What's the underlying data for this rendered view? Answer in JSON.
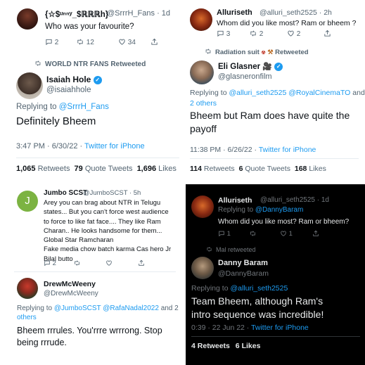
{
  "panel1": {
    "top_tweet": {
      "name": "{☆$ᵘⁿⁿʸ_$ℝℝℝh}",
      "handle": "@SrrrH_Fans · 1d",
      "text": "Who was your favourite?",
      "replies": "2",
      "retweets": "12",
      "likes": "34"
    },
    "retweeted_by": "WORLD NTR FANS Retweeted",
    "author_name": "Isaiah Hole",
    "author_handle": "@isaiahhole",
    "replying_prefix": "Replying to",
    "replying_to": "@SrrrH_Fans",
    "text": "Definitely Bheem",
    "time": "3:47 PM · 6/30/22 ·",
    "client": "Twitter for iPhone",
    "stats": {
      "retweets_count": "1,065",
      "retweets_label": "Retweets",
      "quotes_count": "79",
      "quotes_label": "Quote Tweets",
      "likes_count": "1,696",
      "likes_label": "Likes"
    }
  },
  "panel2": {
    "top_tweet": {
      "name": "Alluriseth",
      "handle": "@alluri_seth2525 · 2h",
      "text": "Whom did you like most? Ram or bheem ?",
      "replies": "3",
      "retweets": "2",
      "likes": "2"
    },
    "retweeted_by": "Radiation suit",
    "retweeted_suffix": "Retweeted",
    "author_name": "Eli Glasner",
    "author_handle": "@glasneronfilm",
    "replying_prefix": "Replying to",
    "replying_to_1": "@alluri_seth2525",
    "replying_to_2": "@RoyalCinemaTO",
    "replying_and": "and",
    "replying_others": "2 others",
    "text": "Bheem but Ram does have quite the payoff",
    "time": "11:38 PM · 6/26/22 ·",
    "client": "Twitter for iPhone",
    "stats": {
      "retweets_count": "114",
      "retweets_label": "Retweets",
      "quotes_count": "6",
      "quotes_label": "Quote Tweets",
      "likes_count": "168",
      "likes_label": "Likes"
    }
  },
  "panel3": {
    "top_tweet": {
      "name": "Jumbo SCST",
      "handle": "@JumboSCST · 5h",
      "avatar_letter": "J",
      "lines": [
        "Arey you can brag about NTR in Telugu",
        "states... But you can't force west audience",
        "to force to like fat face.... They like Ram",
        "Charan.. He looks handsome for them...",
        "Global Star Ramcharan",
        "Fake media chow batch karma Cas hero Jr",
        "Bilal butto"
      ],
      "replies": "2"
    },
    "author_name": "DrewMcWeeny",
    "author_handle": "@DrewMcWeeny",
    "replying_prefix": "Replying to",
    "replying_to_1": "@JumboSCST",
    "replying_to_2": "@RafaNadal2022",
    "replying_and": "and 2",
    "replying_others": "others",
    "text": "Bheem rrrules. You'rrre wrrrong. Stop being rrrude."
  },
  "panel4": {
    "top_tweet": {
      "name": "Alluriseth",
      "handle": "@alluri_seth2525 · 1d",
      "replying_prefix": "Replying to",
      "replying_to": "@DannyBaram",
      "text": "Whom did you like most? Ram or bheem?",
      "replies": "1",
      "likes": "1"
    },
    "retweeted_by": "Mal retweeted",
    "author_name": "Danny Baram",
    "author_handle": "@DannyBaram",
    "replying_prefix": "Replying to",
    "replying_to": "@alluri_seth2525",
    "text_line1": "Team Bheem, although Ram's",
    "text_line2": "intro sequence was incredible!",
    "time": "0:39 · 22 Jun 22 ·",
    "client": "Twitter for iPhone",
    "stats": {
      "retweets_count": "4",
      "retweets_label": "Retweets",
      "likes_count": "6",
      "likes_label": "Likes"
    }
  }
}
